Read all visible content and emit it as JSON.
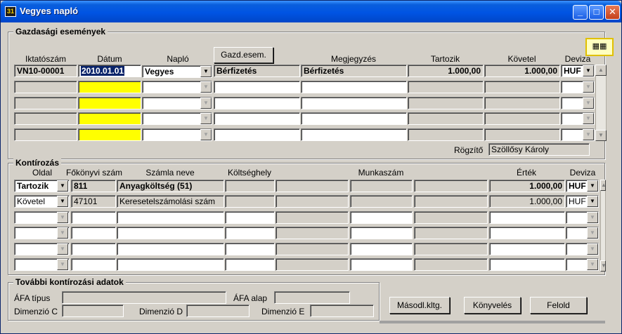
{
  "window": {
    "title": "Vegyes napló",
    "app_icon_text": "31"
  },
  "titlebar_buttons": {
    "minimize": "_",
    "maximize": "□",
    "close": "✕"
  },
  "events_section": {
    "label": "Gazdasági események",
    "headers": {
      "iktatoszam": "Iktatószám",
      "datum": "Dátum",
      "naplo": "Napló",
      "megjegyzes": "Megjegyzés",
      "tartozik": "Tartozik",
      "kovetel": "Követel",
      "deviza": "Deviza"
    },
    "gazd_button": "Gazd.esem.",
    "row1": {
      "iktatoszam": "VN10-00001",
      "datum": "2010.01.01",
      "naplo": "Vegyes",
      "gazd": "Bérfizetés",
      "megjegyzes": "Bérfizetés",
      "tartozik": "1.000,00",
      "kovetel": "1.000,00",
      "deviza": "HUF"
    },
    "rogzito_label": "Rögzítő",
    "rogzito_value": "Szöllősy Károly"
  },
  "kontirozas_section": {
    "label": "Kontírozás",
    "headers": {
      "oldal": "Oldal",
      "fokonyvi": "Főkönyvi szám",
      "szamla_neve": "Számla neve",
      "koltseghely": "Költséghely",
      "munkaszam": "Munkaszám",
      "ertek": "Érték",
      "deviza": "Deviza"
    },
    "rows": [
      {
        "oldal": "Tartozik",
        "fokonyvi": "811",
        "szamla_neve": "Anyagköltség (51)",
        "ertek": "1.000,00",
        "deviza": "HUF"
      },
      {
        "oldal": "Követel",
        "fokonyvi": "47101",
        "szamla_neve": "Keresetelszámolási szám",
        "ertek": "1.000,00",
        "deviza": "HUF"
      }
    ]
  },
  "further_section": {
    "label": "További kontírozási adatok",
    "afa_tipus": "ÁFA típus",
    "afa_alap": "ÁFA alap",
    "dim_c": "Dimenzió C",
    "dim_d": "Dimenzió D",
    "dim_e": "Dimenzió E"
  },
  "buttons": {
    "masodl": "Másodl.kltg.",
    "konyveles": "Könyvelés",
    "felold": "Felold"
  },
  "icons": {
    "toolbar": "calendar-pair-icon",
    "dropdown": "▼",
    "scroll_up": "▲",
    "scroll_down": "▼"
  }
}
